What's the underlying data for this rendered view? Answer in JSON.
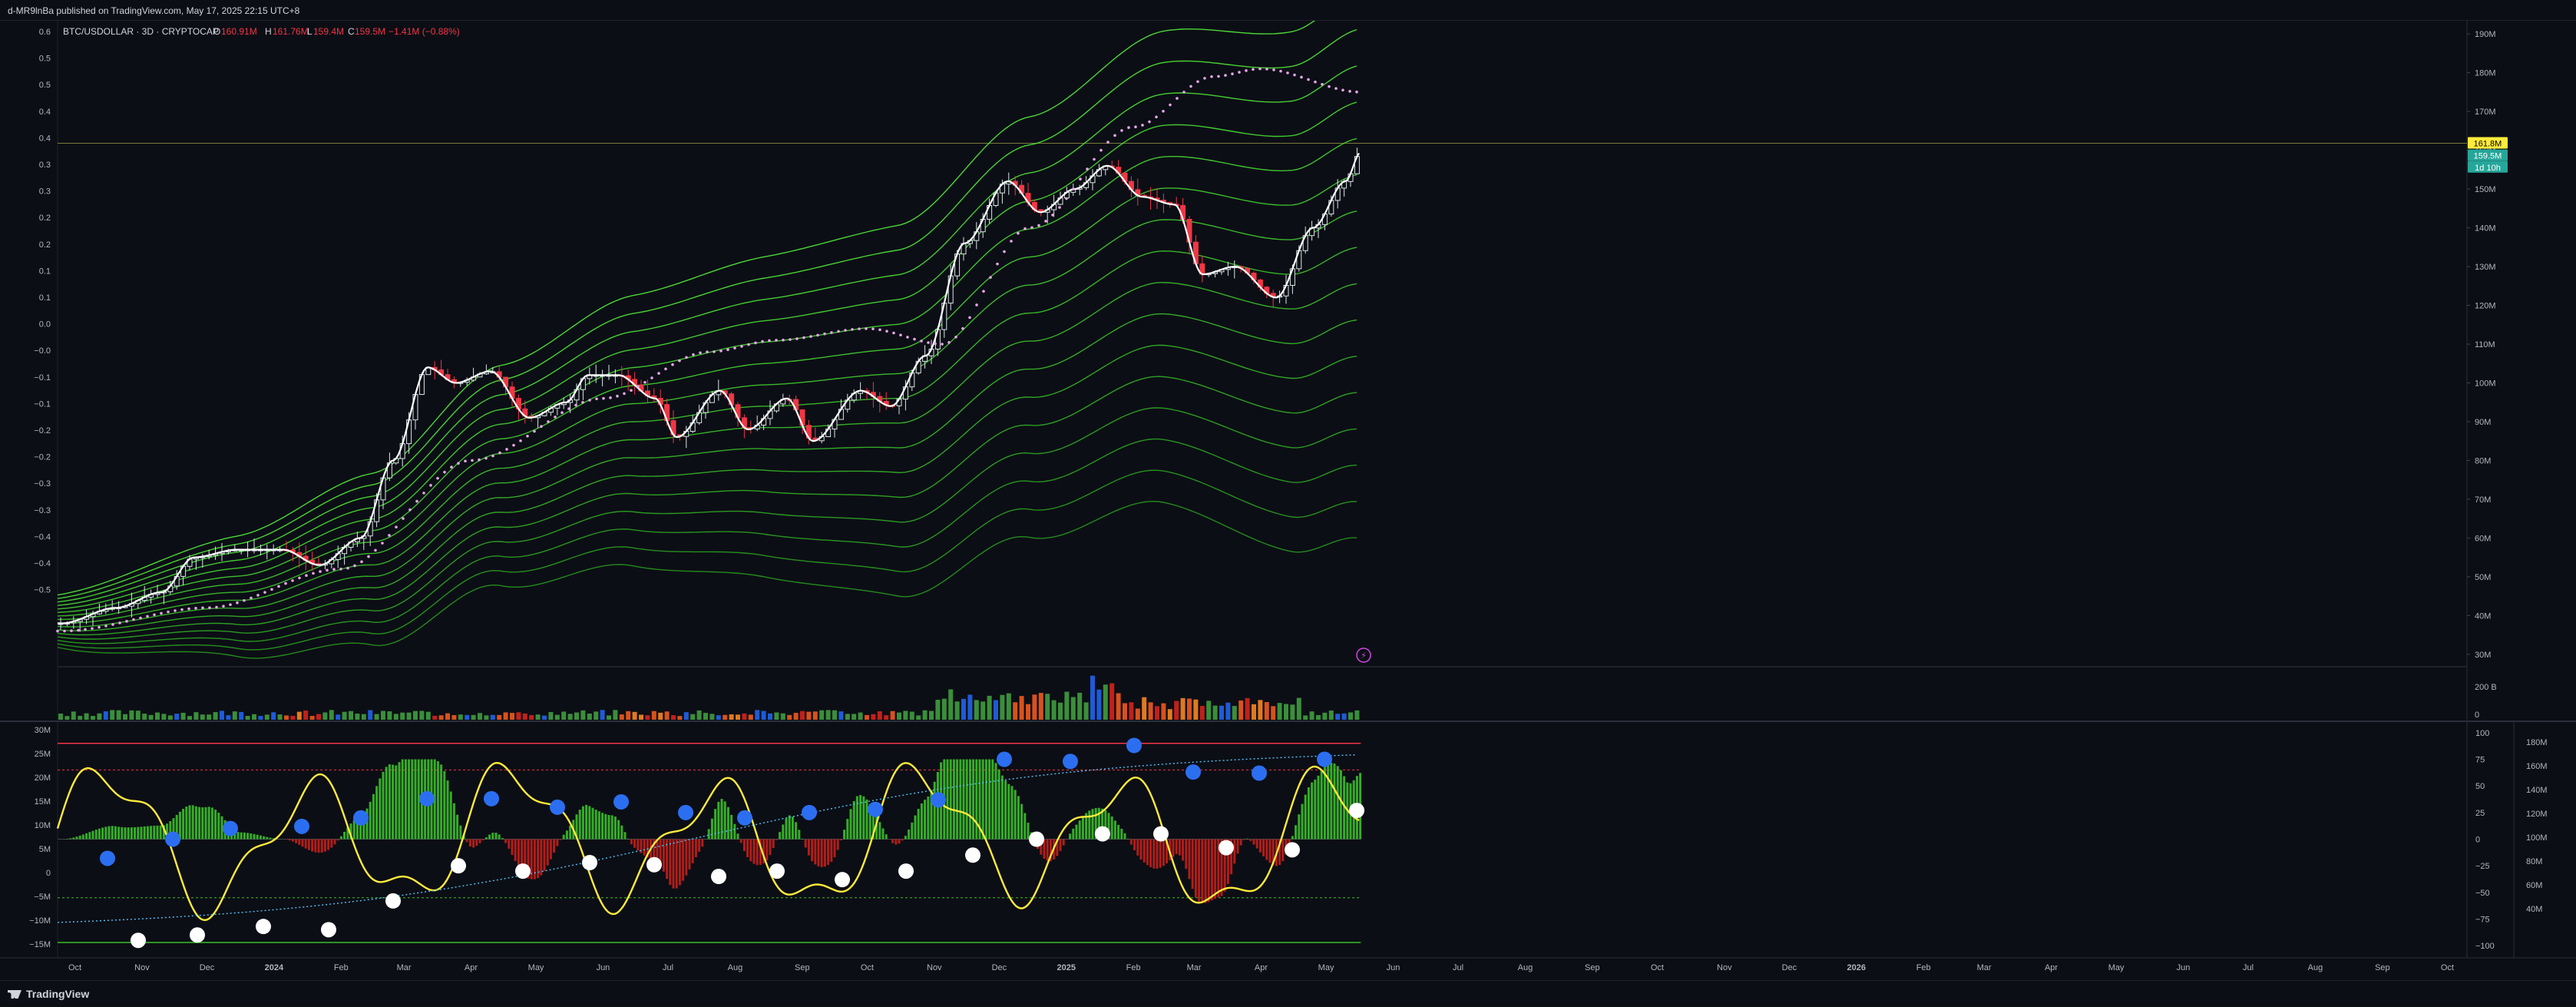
{
  "header": {
    "publisher": "d-MR9lnBa published on TradingView.com, May 17, 2025 22:15 UTC+8"
  },
  "footer": {
    "logo": "TradingView"
  },
  "colors": {
    "background": "#0c0e15",
    "up": "#ffffff",
    "down": "#f23645",
    "accent_yellow": "#ffeb3b",
    "ribbon": "#3bbf2a",
    "dots": "#e07bd2",
    "blue_dot": "#2b6ff0",
    "red_line": "#f23645"
  },
  "chart_data": {
    "type": "line",
    "symbol_label": "BTC/USDOLLAR · 3D · CRYPTOCAP",
    "ohlc": {
      "o_label": "O",
      "o": "160.91M",
      "h_label": "H",
      "h": "161.76M",
      "l_label": "L",
      "l": "159.4M",
      "c_label": "C",
      "c": "159.5M",
      "change": "−1.41M (−0.88%)"
    },
    "left_axis_ticks": [
      "0.6",
      "0.5",
      "0.5",
      "0.4",
      "0.4",
      "0.3",
      "0.3",
      "0.2",
      "0.2",
      "0.1",
      "0.1",
      "0.0",
      "−0.0",
      "−0.1",
      "−0.1",
      "−0.2",
      "−0.2",
      "−0.3",
      "−0.3",
      "−0.4",
      "−0.4",
      "−0.5"
    ],
    "right_axis_ticks": [
      "190M",
      "180M",
      "170M",
      "160M",
      "150M",
      "140M",
      "130M",
      "120M",
      "110M",
      "100M",
      "90M",
      "80M",
      "70M",
      "60M",
      "50M",
      "40M",
      "30M"
    ],
    "ylim": [
      27,
      193
    ],
    "price_tags": [
      {
        "label": "161.8M",
        "color": "#ffeb3b",
        "text_color": "#000000"
      },
      {
        "label": "159.5M",
        "color": "#26a69a",
        "text_color": "#ffffff"
      },
      {
        "label": "1d 10h",
        "color": "#26a69a",
        "text_color": "#ffffff"
      }
    ],
    "time_axis": [
      "Oct",
      "Nov",
      "Dec",
      "2024",
      "Feb",
      "Mar",
      "Apr",
      "May",
      "Jun",
      "Jul",
      "Aug",
      "Sep",
      "Oct",
      "Nov",
      "Dec",
      "2025",
      "Feb",
      "Mar",
      "Apr",
      "May",
      "Jun",
      "Jul",
      "Aug",
      "Sep",
      "Oct",
      "Nov",
      "Dec",
      "2026",
      "Feb",
      "Mar",
      "Apr",
      "May",
      "Jun",
      "Jul",
      "Aug",
      "Sep",
      "Oct"
    ],
    "price_series": [
      {
        "date": "2023-09-25",
        "value": 38
      },
      {
        "date": "2023-10-20",
        "value": 42
      },
      {
        "date": "2023-11-10",
        "value": 46
      },
      {
        "date": "2023-11-25",
        "value": 55
      },
      {
        "date": "2023-12-15",
        "value": 57
      },
      {
        "date": "2024-01-05",
        "value": 57
      },
      {
        "date": "2024-01-22",
        "value": 53
      },
      {
        "date": "2024-02-10",
        "value": 60
      },
      {
        "date": "2024-02-25",
        "value": 80
      },
      {
        "date": "2024-03-12",
        "value": 104
      },
      {
        "date": "2024-03-25",
        "value": 100
      },
      {
        "date": "2024-04-10",
        "value": 103
      },
      {
        "date": "2024-04-28",
        "value": 91
      },
      {
        "date": "2024-05-15",
        "value": 95
      },
      {
        "date": "2024-05-25",
        "value": 102
      },
      {
        "date": "2024-06-08",
        "value": 102
      },
      {
        "date": "2024-06-25",
        "value": 96
      },
      {
        "date": "2024-07-05",
        "value": 86
      },
      {
        "date": "2024-07-25",
        "value": 98
      },
      {
        "date": "2024-08-07",
        "value": 88
      },
      {
        "date": "2024-08-25",
        "value": 96
      },
      {
        "date": "2024-09-06",
        "value": 85
      },
      {
        "date": "2024-09-28",
        "value": 98
      },
      {
        "date": "2024-10-12",
        "value": 94
      },
      {
        "date": "2024-10-28",
        "value": 107
      },
      {
        "date": "2024-11-15",
        "value": 136
      },
      {
        "date": "2024-12-05",
        "value": 152
      },
      {
        "date": "2024-12-20",
        "value": 144
      },
      {
        "date": "2025-01-05",
        "value": 150
      },
      {
        "date": "2025-01-20",
        "value": 156
      },
      {
        "date": "2025-02-05",
        "value": 148
      },
      {
        "date": "2025-02-20",
        "value": 146
      },
      {
        "date": "2025-03-05",
        "value": 128
      },
      {
        "date": "2025-03-20",
        "value": 130
      },
      {
        "date": "2025-04-08",
        "value": 122
      },
      {
        "date": "2025-04-25",
        "value": 140
      },
      {
        "date": "2025-05-10",
        "value": 152
      },
      {
        "date": "2025-05-17",
        "value": 159.5
      }
    ],
    "sma_dots": [
      {
        "date": "2023-09-25",
        "value": 36
      },
      {
        "date": "2023-12-01",
        "value": 42
      },
      {
        "date": "2024-02-01",
        "value": 52
      },
      {
        "date": "2024-04-01",
        "value": 80
      },
      {
        "date": "2024-06-01",
        "value": 96
      },
      {
        "date": "2024-07-20",
        "value": 108
      },
      {
        "date": "2024-08-20",
        "value": 111
      },
      {
        "date": "2024-10-01",
        "value": 114
      },
      {
        "date": "2024-11-05",
        "value": 110
      },
      {
        "date": "2024-12-15",
        "value": 140
      },
      {
        "date": "2025-02-01",
        "value": 166
      },
      {
        "date": "2025-03-10",
        "value": 179
      },
      {
        "date": "2025-04-01",
        "value": 181
      },
      {
        "date": "2025-05-17",
        "value": 175
      }
    ],
    "ribbon_center": [
      {
        "date": "2023-09-25",
        "value": 39
      },
      {
        "date": "2023-12-15",
        "value": 46
      },
      {
        "date": "2024-02-15",
        "value": 56
      },
      {
        "date": "2024-04-15",
        "value": 78
      },
      {
        "date": "2024-06-15",
        "value": 90
      },
      {
        "date": "2024-08-15",
        "value": 94
      },
      {
        "date": "2024-10-15",
        "value": 96
      },
      {
        "date": "2024-12-15",
        "value": 118
      },
      {
        "date": "2025-02-15",
        "value": 134
      },
      {
        "date": "2025-04-15",
        "value": 128
      },
      {
        "date": "2025-05-17",
        "value": 135
      }
    ],
    "volume": {
      "ylim": [
        0,
        250
      ],
      "ticks": [
        "200 B",
        "0"
      ]
    },
    "oscillator": {
      "left_ticks": [
        "30M",
        "25M",
        "20M",
        "15M",
        "10M",
        "5M",
        "0",
        "−5M",
        "−10M",
        "−15M"
      ],
      "right_ticks": [
        "100",
        "75",
        "50",
        "25",
        "0",
        "−25",
        "−50",
        "−75",
        "−100"
      ],
      "far_right_ticks": [
        "180M",
        "160M",
        "140M",
        "120M",
        "100M",
        "80M",
        "60M",
        "40M"
      ],
      "ylim": [
        -110,
        110
      ],
      "upper_line": 90,
      "dashed_levels": [
        65,
        -55
      ],
      "lower_line": -97
    },
    "grid": false,
    "legend": "top-left"
  }
}
